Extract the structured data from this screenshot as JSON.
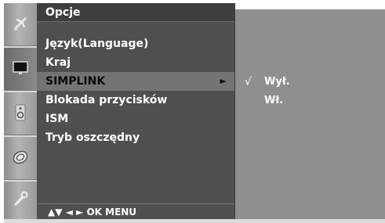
{
  "menu": {
    "title": "Opcje",
    "items": [
      {
        "label": "Język(Language)"
      },
      {
        "label": "Kraj"
      },
      {
        "label": "SIMPLINK",
        "selected": true,
        "arrow": "►"
      },
      {
        "label": "Blokada przycisków"
      },
      {
        "label": "ISM"
      },
      {
        "label": "Tryb oszczędny"
      }
    ],
    "nav_hint": "▲▼  ◄ ►  OK  MENU"
  },
  "submenu": {
    "items": [
      {
        "label": "Wył.",
        "check": "√"
      },
      {
        "label": "Wł.",
        "check": ""
      }
    ]
  },
  "icons": [
    "satellite-dish-icon",
    "screen-icon",
    "speaker-icon",
    "clock-icon",
    "option-wrench-icon"
  ],
  "colors": {
    "panel": "#4f4f4f",
    "selection": "#747474",
    "subpanel": "#8f8f8f",
    "strip": "#a0a0a0"
  }
}
